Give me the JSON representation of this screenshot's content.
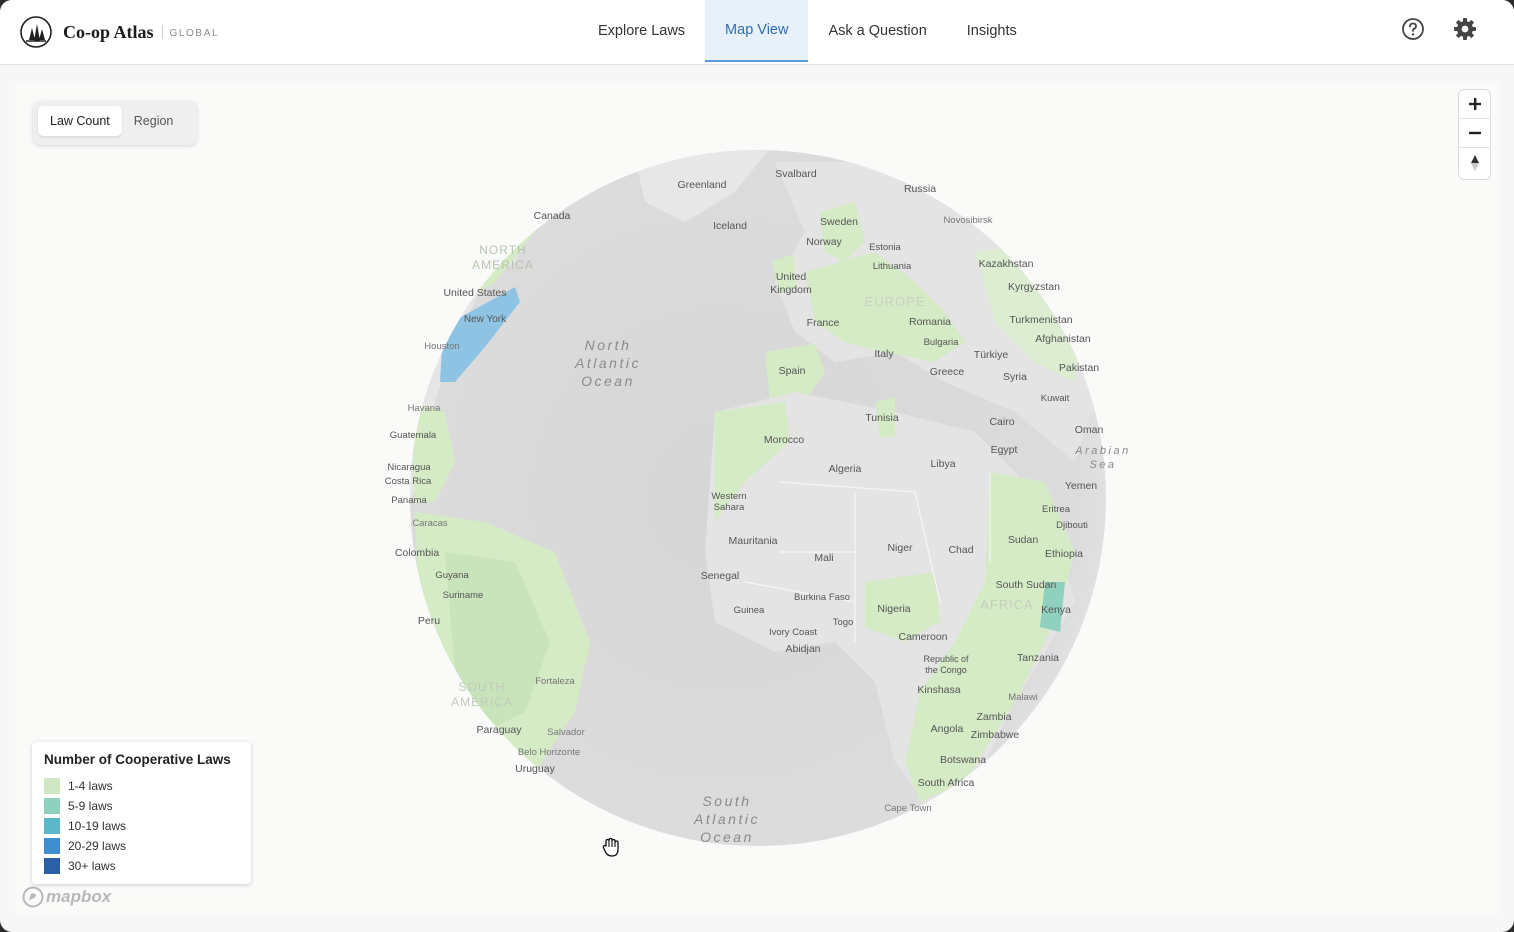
{
  "app": {
    "name": "Co-op Atlas",
    "subtitle": "GLOBAL"
  },
  "nav": {
    "tabs": [
      {
        "label": "Explore Laws",
        "active": false
      },
      {
        "label": "Map View",
        "active": true
      },
      {
        "label": "Ask a Question",
        "active": false
      },
      {
        "label": "Insights",
        "active": false
      }
    ]
  },
  "header_icons": [
    "help-icon",
    "gear-icon"
  ],
  "map_toggle": {
    "options": [
      "Law Count",
      "Region"
    ],
    "selected": "Law Count"
  },
  "zoom_controls": {
    "zoom_in": "+",
    "zoom_out": "−",
    "compass": "north-arrow-icon"
  },
  "legend": {
    "title": "Number of Cooperative Laws",
    "items": [
      {
        "label": "1-4 laws",
        "color": "#cfe8c3"
      },
      {
        "label": "5-9 laws",
        "color": "#8fd0be"
      },
      {
        "label": "10-19 laws",
        "color": "#5bb8c8"
      },
      {
        "label": "20-29 laws",
        "color": "#3f8fd0"
      },
      {
        "label": "30+ laws",
        "color": "#2c5fa6"
      }
    ]
  },
  "attribution": "mapbox",
  "map_labels": {
    "regions": [
      "NORTH AMERICA",
      "EUROPE",
      "AFRICA",
      "SOUTH AMERICA"
    ],
    "oceans": [
      "North Atlantic Ocean",
      "South Atlantic Ocean",
      "Arabian Sea"
    ],
    "places": [
      "Greenland",
      "Svalbard",
      "Russia",
      "Canada",
      "Iceland",
      "Sweden",
      "Novosibirsk",
      "Norway",
      "Estonia",
      "Lithuania",
      "United Kingdom",
      "Kazakhstan",
      "United States",
      "Kyrgyzstan",
      "New York",
      "France",
      "Romania",
      "Turkmenistan",
      "Houston",
      "Bulgaria",
      "Afghanistan",
      "Italy",
      "Türkiye",
      "Spain",
      "Greece",
      "Syria",
      "Pakistan",
      "Havana",
      "Tunisia",
      "Kuwait",
      "Cairo",
      "Oman",
      "Guatemala",
      "Morocco",
      "Egypt",
      "Algeria",
      "Libya",
      "Nicaragua",
      "Costa Rica",
      "Yemen",
      "Western Sahara",
      "Panama",
      "Eritrea",
      "Caracas",
      "Djibouti",
      "Mauritania",
      "Sudan",
      "Colombia",
      "Niger",
      "Chad",
      "Mali",
      "Ethiopia",
      "Guyana",
      "Senegal",
      "South Sudan",
      "Suriname",
      "Burkina Faso",
      "Nigeria",
      "Guinea",
      "Kenya",
      "Peru",
      "Togo",
      "Ivory Coast",
      "Cameroon",
      "Abidjan",
      "Tanzania",
      "Republic of the Congo",
      "Fortaleza",
      "Kinshasa",
      "Malawi",
      "Zambia",
      "Paraguay",
      "Salvador",
      "Angola",
      "Zimbabwe",
      "Belo Horizonte",
      "Botswana",
      "Uruguay",
      "South Africa",
      "Cape Town"
    ]
  },
  "map_colors": {
    "land_default": "#e3e3e3",
    "ocean": "#d9d9d9",
    "tier1": "#cfe8c3",
    "tier3": "#5bb8c8",
    "tier4": "#8fc3e3"
  }
}
